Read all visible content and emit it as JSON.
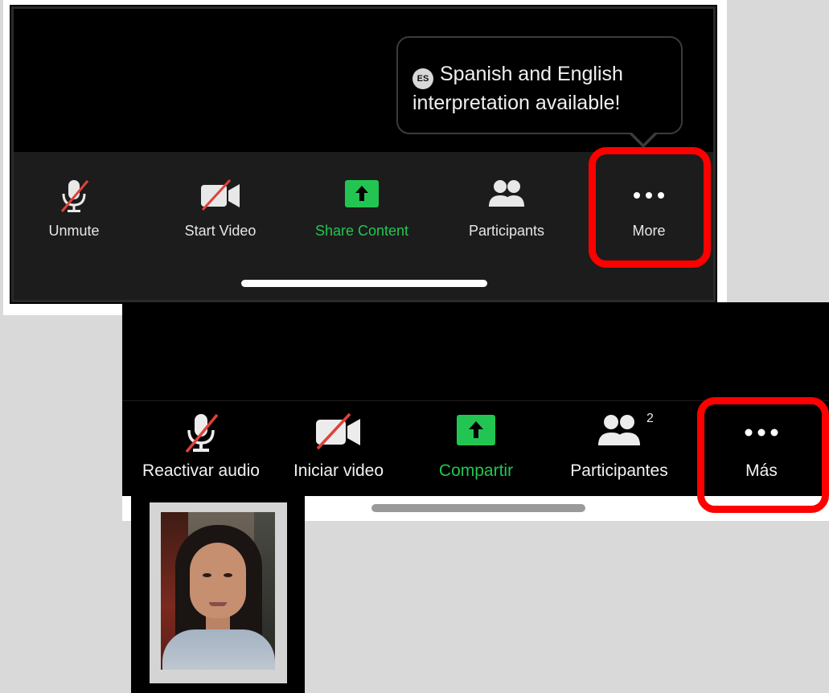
{
  "english_toolbar": {
    "tooltip": {
      "badge": "ES",
      "line1": "Spanish and English",
      "line2": "interpretation available!"
    },
    "items": [
      {
        "label": "Unmute",
        "icon": "microphone-muted-icon"
      },
      {
        "label": "Start Video",
        "icon": "video-off-icon"
      },
      {
        "label": "Share Content",
        "icon": "share-upload-icon"
      },
      {
        "label": "Participants",
        "icon": "participants-icon"
      },
      {
        "label": "More",
        "icon": "more-dots-icon"
      }
    ]
  },
  "spanish_toolbar": {
    "participant_count": "2",
    "items": [
      {
        "label": "Reactivar audio",
        "icon": "microphone-muted-icon"
      },
      {
        "label": "Iniciar video",
        "icon": "video-off-icon"
      },
      {
        "label": "Compartir",
        "icon": "share-upload-icon"
      },
      {
        "label": "Participantes",
        "icon": "participants-icon"
      },
      {
        "label": "Más",
        "icon": "more-dots-icon"
      }
    ]
  },
  "colors": {
    "share_green": "#23c552",
    "highlight_red": "#ff0000",
    "toolbar_bg": "#1c1c1c",
    "slash_red": "#e0413b"
  }
}
